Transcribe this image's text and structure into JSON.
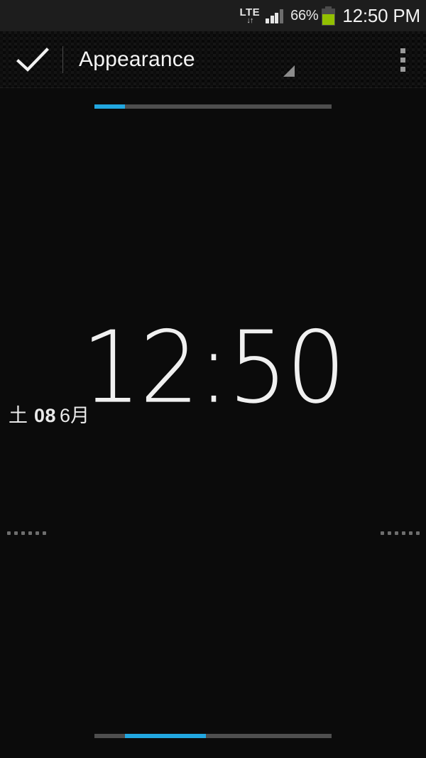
{
  "statusbar": {
    "network_type": "LTE",
    "network_arrows": "↓↑",
    "signal_bars_total": 4,
    "signal_bars_active": 3,
    "battery_percent_label": "66%",
    "battery_percent_value": 66,
    "battery_color": "#92c000",
    "clock": "12:50 PM"
  },
  "actionbar": {
    "done_icon": "check-icon",
    "title": "Appearance",
    "spinner_icon": "dropdown-triangle-icon",
    "overflow_icon": "overflow-menu-icon"
  },
  "indicators": {
    "accent_color": "#22a7e0",
    "track_color": "#4e4e4e",
    "top": {
      "name": "appearance-page-indicator",
      "segment_start_pct": 0,
      "segment_width_pct": 13
    },
    "bottom": {
      "name": "style-page-indicator",
      "segment_start_pct": 13,
      "segment_width_pct": 34
    }
  },
  "widget": {
    "time": "12:50",
    "date": {
      "day_of_week": "土",
      "day": "08",
      "month": "6月"
    },
    "grip_dots_count": 6
  }
}
